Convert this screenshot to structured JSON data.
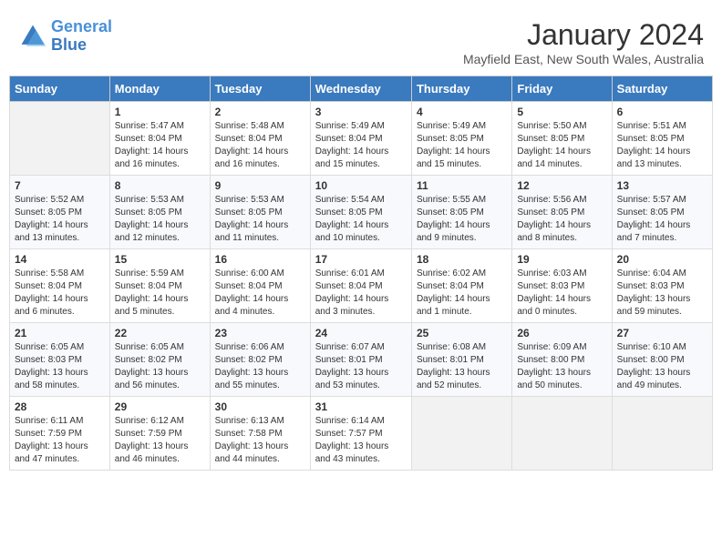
{
  "header": {
    "logo_line1": "General",
    "logo_line2": "Blue",
    "month": "January 2024",
    "location": "Mayfield East, New South Wales, Australia"
  },
  "weekdays": [
    "Sunday",
    "Monday",
    "Tuesday",
    "Wednesday",
    "Thursday",
    "Friday",
    "Saturday"
  ],
  "weeks": [
    [
      {
        "day": "",
        "info": ""
      },
      {
        "day": "1",
        "info": "Sunrise: 5:47 AM\nSunset: 8:04 PM\nDaylight: 14 hours\nand 16 minutes."
      },
      {
        "day": "2",
        "info": "Sunrise: 5:48 AM\nSunset: 8:04 PM\nDaylight: 14 hours\nand 16 minutes."
      },
      {
        "day": "3",
        "info": "Sunrise: 5:49 AM\nSunset: 8:04 PM\nDaylight: 14 hours\nand 15 minutes."
      },
      {
        "day": "4",
        "info": "Sunrise: 5:49 AM\nSunset: 8:05 PM\nDaylight: 14 hours\nand 15 minutes."
      },
      {
        "day": "5",
        "info": "Sunrise: 5:50 AM\nSunset: 8:05 PM\nDaylight: 14 hours\nand 14 minutes."
      },
      {
        "day": "6",
        "info": "Sunrise: 5:51 AM\nSunset: 8:05 PM\nDaylight: 14 hours\nand 13 minutes."
      }
    ],
    [
      {
        "day": "7",
        "info": "Sunrise: 5:52 AM\nSunset: 8:05 PM\nDaylight: 14 hours\nand 13 minutes."
      },
      {
        "day": "8",
        "info": "Sunrise: 5:53 AM\nSunset: 8:05 PM\nDaylight: 14 hours\nand 12 minutes."
      },
      {
        "day": "9",
        "info": "Sunrise: 5:53 AM\nSunset: 8:05 PM\nDaylight: 14 hours\nand 11 minutes."
      },
      {
        "day": "10",
        "info": "Sunrise: 5:54 AM\nSunset: 8:05 PM\nDaylight: 14 hours\nand 10 minutes."
      },
      {
        "day": "11",
        "info": "Sunrise: 5:55 AM\nSunset: 8:05 PM\nDaylight: 14 hours\nand 9 minutes."
      },
      {
        "day": "12",
        "info": "Sunrise: 5:56 AM\nSunset: 8:05 PM\nDaylight: 14 hours\nand 8 minutes."
      },
      {
        "day": "13",
        "info": "Sunrise: 5:57 AM\nSunset: 8:05 PM\nDaylight: 14 hours\nand 7 minutes."
      }
    ],
    [
      {
        "day": "14",
        "info": "Sunrise: 5:58 AM\nSunset: 8:04 PM\nDaylight: 14 hours\nand 6 minutes."
      },
      {
        "day": "15",
        "info": "Sunrise: 5:59 AM\nSunset: 8:04 PM\nDaylight: 14 hours\nand 5 minutes."
      },
      {
        "day": "16",
        "info": "Sunrise: 6:00 AM\nSunset: 8:04 PM\nDaylight: 14 hours\nand 4 minutes."
      },
      {
        "day": "17",
        "info": "Sunrise: 6:01 AM\nSunset: 8:04 PM\nDaylight: 14 hours\nand 3 minutes."
      },
      {
        "day": "18",
        "info": "Sunrise: 6:02 AM\nSunset: 8:04 PM\nDaylight: 14 hours\nand 1 minute."
      },
      {
        "day": "19",
        "info": "Sunrise: 6:03 AM\nSunset: 8:03 PM\nDaylight: 14 hours\nand 0 minutes."
      },
      {
        "day": "20",
        "info": "Sunrise: 6:04 AM\nSunset: 8:03 PM\nDaylight: 13 hours\nand 59 minutes."
      }
    ],
    [
      {
        "day": "21",
        "info": "Sunrise: 6:05 AM\nSunset: 8:03 PM\nDaylight: 13 hours\nand 58 minutes."
      },
      {
        "day": "22",
        "info": "Sunrise: 6:05 AM\nSunset: 8:02 PM\nDaylight: 13 hours\nand 56 minutes."
      },
      {
        "day": "23",
        "info": "Sunrise: 6:06 AM\nSunset: 8:02 PM\nDaylight: 13 hours\nand 55 minutes."
      },
      {
        "day": "24",
        "info": "Sunrise: 6:07 AM\nSunset: 8:01 PM\nDaylight: 13 hours\nand 53 minutes."
      },
      {
        "day": "25",
        "info": "Sunrise: 6:08 AM\nSunset: 8:01 PM\nDaylight: 13 hours\nand 52 minutes."
      },
      {
        "day": "26",
        "info": "Sunrise: 6:09 AM\nSunset: 8:00 PM\nDaylight: 13 hours\nand 50 minutes."
      },
      {
        "day": "27",
        "info": "Sunrise: 6:10 AM\nSunset: 8:00 PM\nDaylight: 13 hours\nand 49 minutes."
      }
    ],
    [
      {
        "day": "28",
        "info": "Sunrise: 6:11 AM\nSunset: 7:59 PM\nDaylight: 13 hours\nand 47 minutes."
      },
      {
        "day": "29",
        "info": "Sunrise: 6:12 AM\nSunset: 7:59 PM\nDaylight: 13 hours\nand 46 minutes."
      },
      {
        "day": "30",
        "info": "Sunrise: 6:13 AM\nSunset: 7:58 PM\nDaylight: 13 hours\nand 44 minutes."
      },
      {
        "day": "31",
        "info": "Sunrise: 6:14 AM\nSunset: 7:57 PM\nDaylight: 13 hours\nand 43 minutes."
      },
      {
        "day": "",
        "info": ""
      },
      {
        "day": "",
        "info": ""
      },
      {
        "day": "",
        "info": ""
      }
    ]
  ]
}
